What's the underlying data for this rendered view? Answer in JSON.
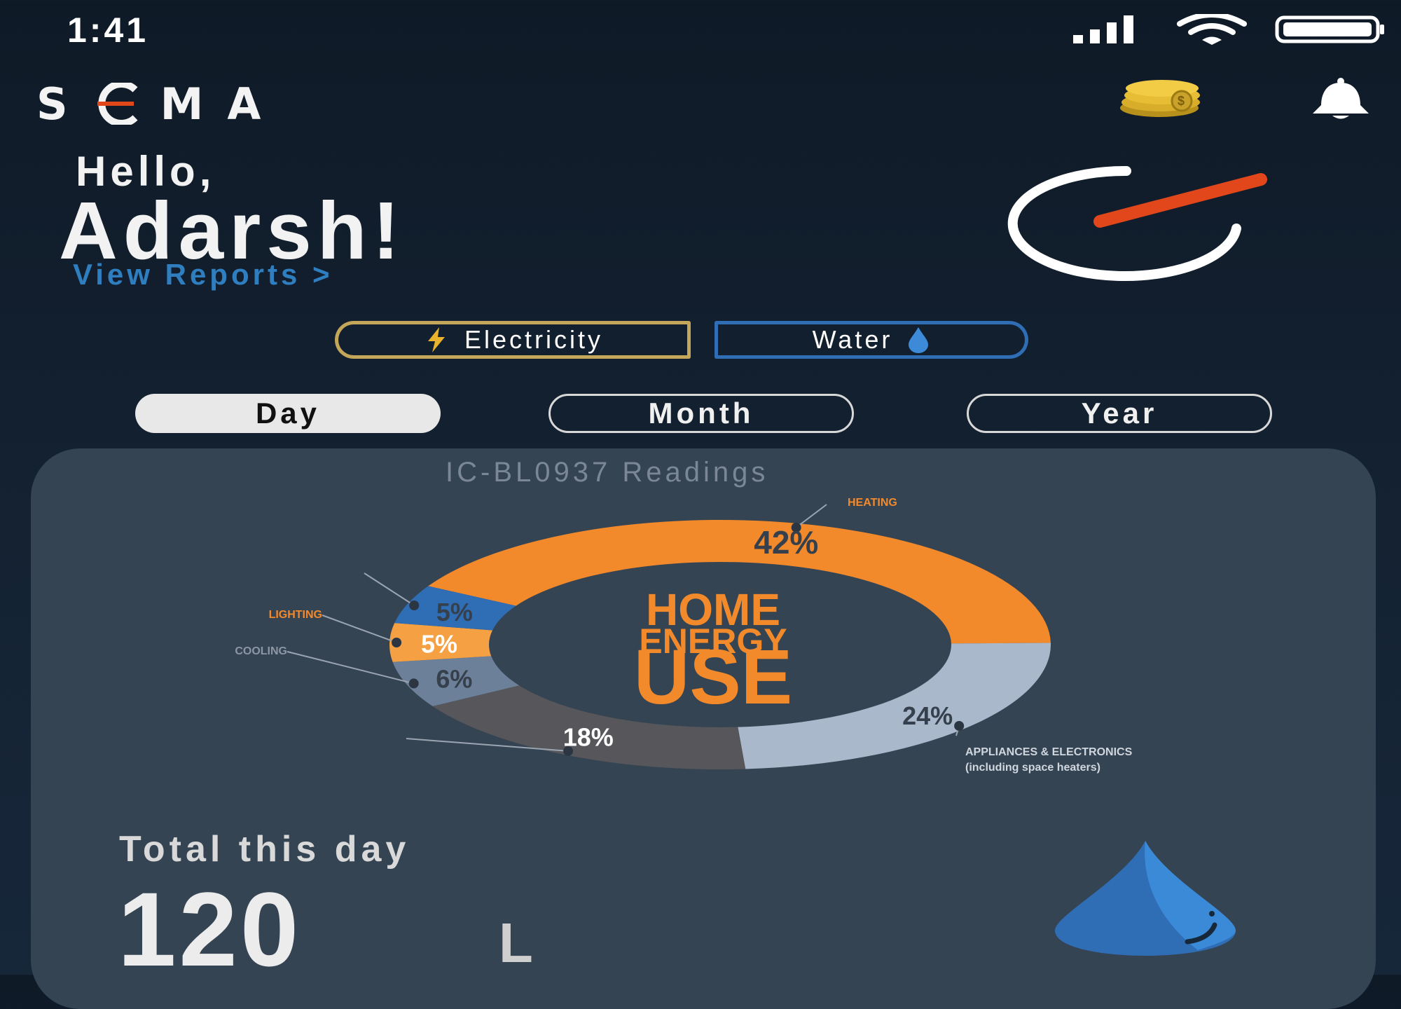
{
  "status_bar": {
    "time": "1:41"
  },
  "header": {
    "logo_letters": [
      "S",
      "C",
      "M",
      "A"
    ],
    "coins_icon": "coins-icon",
    "bell_icon": "bell-icon"
  },
  "greeting": {
    "hello": "Hello,",
    "name": "Adarsh!",
    "view_reports": "View Reports >"
  },
  "utility_toggle": {
    "electricity": "Electricity",
    "water": "Water",
    "selected": "Water"
  },
  "period_tabs": {
    "tabs": [
      "Day",
      "Month",
      "Year"
    ],
    "selected": "Day"
  },
  "readings_card": {
    "title": "IC-BL0937 Readings",
    "summary_label": "Total this day",
    "summary_value": "120",
    "summary_unit": "L"
  },
  "chart_data": {
    "type": "pie",
    "center_text": [
      "HOME",
      "ENERGY",
      "USE"
    ],
    "slices": [
      {
        "label": "HEATING",
        "value": 42,
        "value_label": "42%",
        "color": "#f28a2c"
      },
      {
        "label": "APPLIANCES & ELECTRONICS (including space heaters)",
        "value": 24,
        "value_label": "24%",
        "color": "#a9b8ca"
      },
      {
        "label": "",
        "value": 18,
        "value_label": "18%",
        "color": "#57575b"
      },
      {
        "label": "COOLING",
        "value": 6,
        "value_label": "6%",
        "color": "#6c8199"
      },
      {
        "label": "LIGHTING",
        "value": 5,
        "value_label": "5%",
        "color": "#f5a043"
      },
      {
        "label": "",
        "value": 5,
        "value_label": "5%",
        "color": "#2f6db5"
      }
    ]
  },
  "colors": {
    "accent_blue": "#2f7fc0",
    "accent_orange": "#e2471c",
    "electricity_border": "#c4a65a",
    "water_border": "#2f6db5",
    "card_bg": "#354453"
  }
}
